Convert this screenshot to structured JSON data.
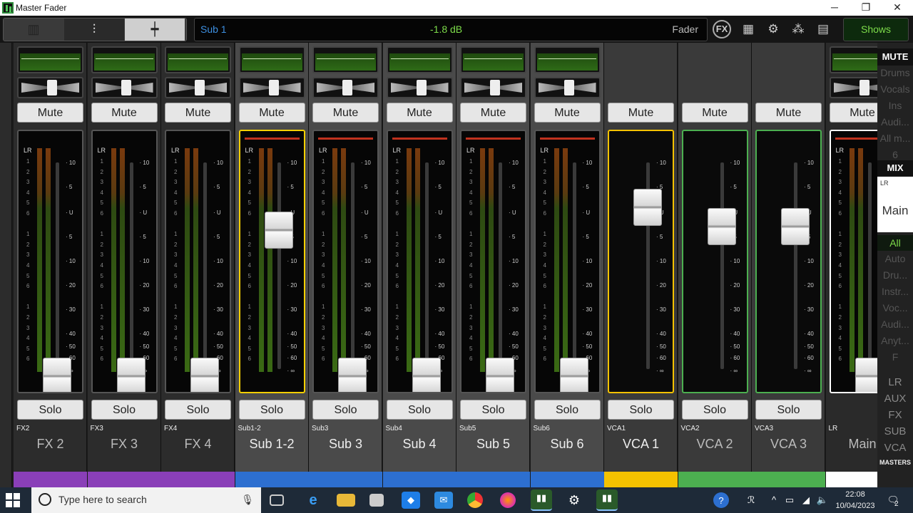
{
  "window": {
    "title": "Master Fader",
    "min": "─",
    "max": "❐",
    "close": "✕"
  },
  "topbar": {
    "channel": "Sub 1",
    "level": "-1.8 dB",
    "mode": "Fader",
    "fx_label": "FX",
    "shows_label": "Shows"
  },
  "strips": [
    {
      "short": "FX2",
      "name": "FX 2",
      "color": "#8a3fb8",
      "fader": 0.0,
      "type": "ch"
    },
    {
      "short": "FX3",
      "name": "FX 3",
      "color": "#8a3fb8",
      "fader": 0.0,
      "type": "ch"
    },
    {
      "short": "FX4",
      "name": "FX 4",
      "color": "#8a3fb8",
      "fader": 0.0,
      "type": "ch"
    },
    {
      "short": "Sub1-2",
      "name": "Sub 1-2",
      "color": "#2d6fd0",
      "fader": 0.78,
      "type": "sub",
      "selected": true
    },
    {
      "short": "Sub3",
      "name": "Sub 3",
      "color": "#2d6fd0",
      "fader": 0.0,
      "type": "sub"
    },
    {
      "short": "Sub4",
      "name": "Sub 4",
      "color": "#2d6fd0",
      "fader": 0.0,
      "type": "sub"
    },
    {
      "short": "Sub5",
      "name": "Sub 5",
      "color": "#2d6fd0",
      "fader": 0.0,
      "type": "sub"
    },
    {
      "short": "Sub6",
      "name": "Sub 6",
      "color": "#2d6fd0",
      "fader": 0.0,
      "type": "sub"
    },
    {
      "short": "VCA1",
      "name": "VCA 1",
      "color": "#f5c200",
      "fader": 0.9,
      "type": "vca"
    },
    {
      "short": "VCA2",
      "name": "VCA 2",
      "color": "#4caf50",
      "fader": 0.8,
      "type": "vca"
    },
    {
      "short": "VCA3",
      "name": "VCA 3",
      "color": "#4caf50",
      "fader": 0.8,
      "type": "vca"
    },
    {
      "short": "LR",
      "name": "Main",
      "color": "#ffffff",
      "fader": 0.0,
      "type": "main"
    }
  ],
  "labels": {
    "mute": "Mute",
    "solo": "Solo",
    "lr": "LR"
  },
  "db_scale": [
    "10",
    "5",
    "U",
    "5",
    "10",
    "20",
    "30",
    "40",
    "50",
    "60",
    "∞"
  ],
  "meter_scale": [
    "1",
    "2",
    "3",
    "4",
    "5",
    "6",
    "",
    "1",
    "2",
    "3",
    "4",
    "5",
    "6",
    "",
    "1",
    "2",
    "3",
    "4",
    "5",
    "6"
  ],
  "right_panel": {
    "mute": "MUTE",
    "mute_groups": [
      "Drums",
      "Vocals",
      "Ins",
      "Audi...",
      "All m...",
      "6"
    ],
    "mix_header": "MIX",
    "mix_sub": "LR",
    "mix_name": "Main",
    "views": [
      "All",
      "Auto",
      "Dru...",
      "Instr...",
      "Voc...",
      "Audi...",
      "Anyt...",
      "F"
    ],
    "banks": [
      "LR",
      "AUX",
      "FX",
      "SUB",
      "VCA"
    ],
    "masters": "MASTERS"
  },
  "taskbar": {
    "search_placeholder": "Type here to search",
    "time": "22:08",
    "date": "10/04/2023",
    "notif_count": "2"
  }
}
